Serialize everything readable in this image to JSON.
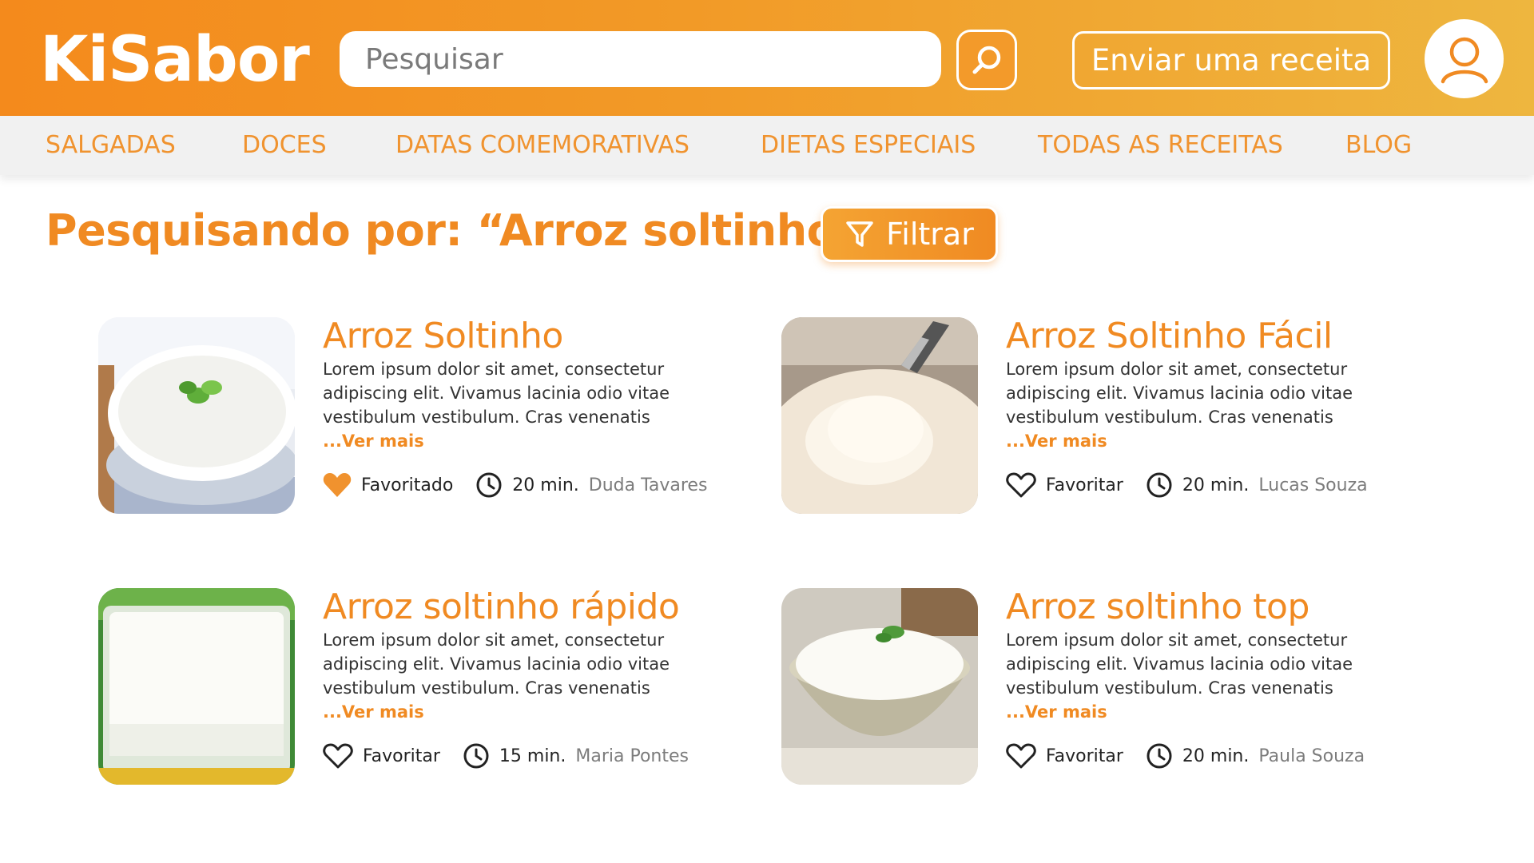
{
  "header": {
    "logo": "KiSabor",
    "search_placeholder": "Pesquisar",
    "search_button_icon": "search-icon",
    "send_recipe_label": "Enviar uma receita",
    "avatar_icon": "user-icon"
  },
  "nav": {
    "items": [
      {
        "label": "SALGADAS"
      },
      {
        "label": "DOCES"
      },
      {
        "label": "DATAS COMEMORATIVAS"
      },
      {
        "label": "DIETAS ESPECIAIS"
      },
      {
        "label": "TODAS AS RECEITAS"
      },
      {
        "label": "BLOG"
      }
    ]
  },
  "results": {
    "title": "Pesquisando por: “Arroz soltinho”",
    "filter_label": "Filtrar"
  },
  "recipes": [
    {
      "title": "Arroz Soltinho",
      "description": "Lorem ipsum dolor sit amet, consectetur adipiscing elit. Vivamus lacinia odio vitae vestibulum vestibulum. Cras venenatis",
      "more": "...Ver mais",
      "favorite_label": "Favoritado",
      "favorited": true,
      "time": "20 min.",
      "author": "Duda Tavares"
    },
    {
      "title": "Arroz Soltinho Fácil",
      "description": "Lorem ipsum dolor sit amet, consectetur adipiscing elit. Vivamus lacinia odio vitae vestibulum vestibulum. Cras venenatis",
      "more": "...Ver mais",
      "favorite_label": "Favoritar",
      "favorited": false,
      "time": "20 min.",
      "author": "Lucas Souza"
    },
    {
      "title": "Arroz soltinho rápido",
      "description": "Lorem ipsum dolor sit amet, consectetur adipiscing elit. Vivamus lacinia odio vitae vestibulum vestibulum. Cras venenatis",
      "more": "...Ver mais",
      "favorite_label": "Favoritar",
      "favorited": false,
      "time": "15 min.",
      "author": "Maria Pontes"
    },
    {
      "title": "Arroz soltinho top",
      "description": "Lorem ipsum dolor sit amet, consectetur adipiscing elit. Vivamus lacinia odio vitae vestibulum vestibulum. Cras venenatis",
      "more": "...Ver mais",
      "favorite_label": "Favoritar",
      "favorited": false,
      "time": "20 min.",
      "author": "Paula Souza"
    }
  ],
  "colors": {
    "brand_orange": "#f08a22",
    "header_gradient_start": "#f48a1c",
    "header_gradient_end": "#eeb63f",
    "nav_background": "#f1f1f1",
    "muted_text": "#7c7c7c"
  }
}
